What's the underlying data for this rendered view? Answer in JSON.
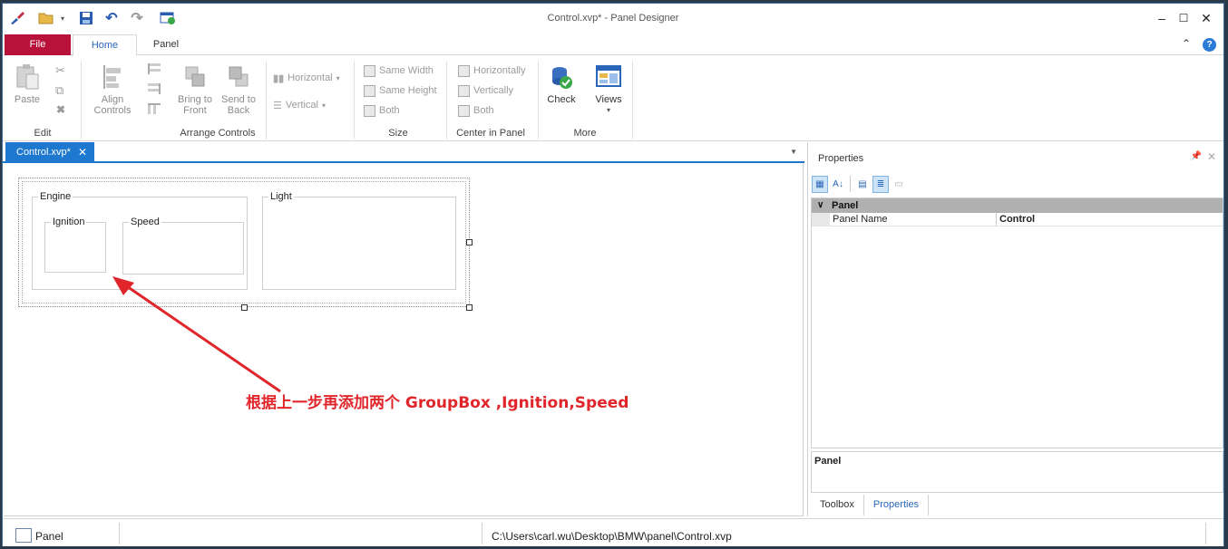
{
  "window": {
    "title": "Control.xvp* - Panel Designer"
  },
  "quick_access": [
    {
      "icon": "customize-brush-icon"
    },
    {
      "icon": "open-folder-icon"
    },
    {
      "icon": "dropdown-arrow-icon"
    },
    {
      "icon": "save-icon"
    },
    {
      "icon": "undo-icon"
    },
    {
      "icon": "redo-icon"
    },
    {
      "icon": "preview-window-icon"
    }
  ],
  "ribbon_tabs": {
    "file": "File",
    "home": "Home",
    "panel": "Panel"
  },
  "ribbon": {
    "edit": {
      "paste": "Paste",
      "group": "Edit"
    },
    "arrange": {
      "align_controls": "Align Controls",
      "bring_to_front": "Bring to Front",
      "send_to_back": "Send to Back",
      "horizontal": "Horizontal",
      "vertical": "Vertical",
      "group": "Arrange Controls"
    },
    "size": {
      "same_width": "Same Width",
      "same_height": "Same Height",
      "both": "Both",
      "group": "Size"
    },
    "center": {
      "horizontally": "Horizontally",
      "vertically": "Vertically",
      "both": "Both",
      "group": "Center in Panel"
    },
    "more": {
      "check": "Check",
      "views": "Views",
      "group": "More"
    }
  },
  "document_tab": {
    "label": "Control.xvp*",
    "close": "✕"
  },
  "designer": {
    "groupboxes": {
      "engine": "Engine",
      "ignition": "Ignition",
      "speed": "Speed",
      "light": "Light"
    },
    "annotation": "根据上一步再添加两个 GroupBox ,Ignition,Speed",
    "annotation_color": "#e0262b"
  },
  "properties": {
    "title": "Properties",
    "category": "Panel",
    "rows": [
      {
        "name": "Panel Name",
        "value": "Control"
      }
    ],
    "description": "Panel",
    "tabs": {
      "toolbox": "Toolbox",
      "properties": "Properties"
    }
  },
  "status_bar": {
    "item": "Panel",
    "path": "C:\\Users\\carl.wu\\Desktop\\BMW\\panel\\Control.xvp"
  },
  "colors": {
    "file_tab": "#b8123a",
    "accent": "#1e78d0",
    "home_tab_text": "#2a66b7"
  }
}
